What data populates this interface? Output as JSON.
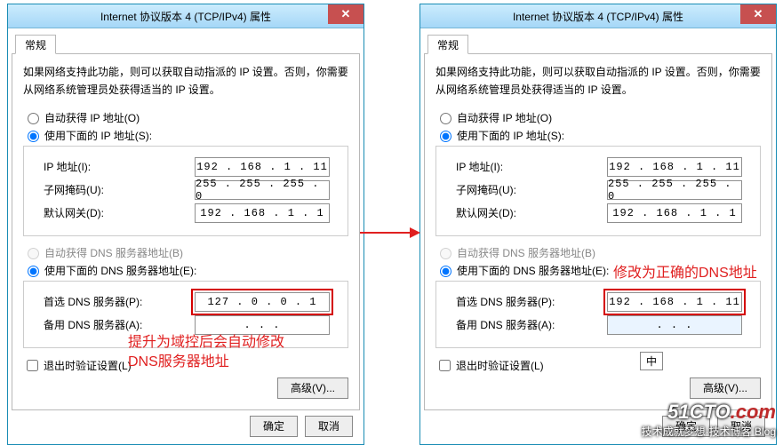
{
  "window_title": "Internet 协议版本 4 (TCP/IPv4) 属性",
  "tab_label": "常规",
  "description": "如果网络支持此功能，则可以获取自动指派的 IP 设置。否则，你需要从网络系统管理员处获得适当的 IP 设置。",
  "radios": {
    "auto_ip": "自动获得 IP 地址(O)",
    "manual_ip": "使用下面的 IP 地址(S):",
    "auto_dns": "自动获得 DNS 服务器地址(B)",
    "manual_dns": "使用下面的 DNS 服务器地址(E):"
  },
  "labels": {
    "ip": "IP 地址(I):",
    "mask": "子网掩码(U):",
    "gw": "默认网关(D):",
    "dns1": "首选 DNS 服务器(P):",
    "dns2": "备用 DNS 服务器(A):",
    "validate": "退出时验证设置(L)",
    "adv": "高级(V)...",
    "ok": "确定",
    "cancel": "取消"
  },
  "left": {
    "ip": "192 . 168 .  1  . 11",
    "mask": "255 . 255 . 255 .  0",
    "gw": "192 . 168 .  1  .  1",
    "dns1": "127 .  0  .  0  .  1",
    "dns2": " .       .       . "
  },
  "right": {
    "ip": "192 . 168 .  1  . 11",
    "mask": "255 . 255 . 255 .  0",
    "gw": "192 . 168 .  1  .  1",
    "dns1": "192 . 168 .  1  . 11",
    "dns2_focused": true,
    "dns2": " .       .       . "
  },
  "annotations": {
    "left": "提升为域控后会自动修改\nDNS服务器地址",
    "right": "修改为正确的DNS地址"
  },
  "ime_indicator": "中",
  "watermark": {
    "line1_a": "51CTO",
    "line1_b": ".com",
    "line2": "技术成就梦想·技术博客 Blog"
  }
}
